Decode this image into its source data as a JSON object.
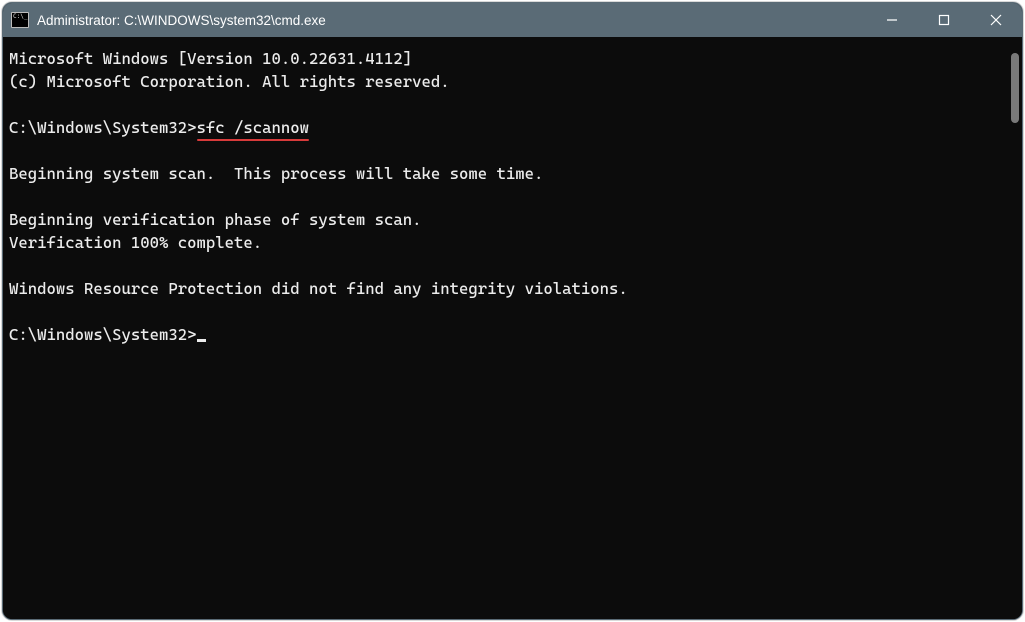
{
  "window": {
    "title": "Administrator: C:\\WINDOWS\\system32\\cmd.exe"
  },
  "terminal": {
    "line1": "Microsoft Windows [Version 10.0.22631.4112]",
    "line2": "(c) Microsoft Corporation. All rights reserved.",
    "prompt1_path": "C:\\Windows\\System32>",
    "prompt1_cmd": "sfc /scannow",
    "line3": "Beginning system scan.  This process will take some time.",
    "line4": "Beginning verification phase of system scan.",
    "line5": "Verification 100% complete.",
    "line6": "Windows Resource Protection did not find any integrity violations.",
    "prompt2_path": "C:\\Windows\\System32>"
  }
}
